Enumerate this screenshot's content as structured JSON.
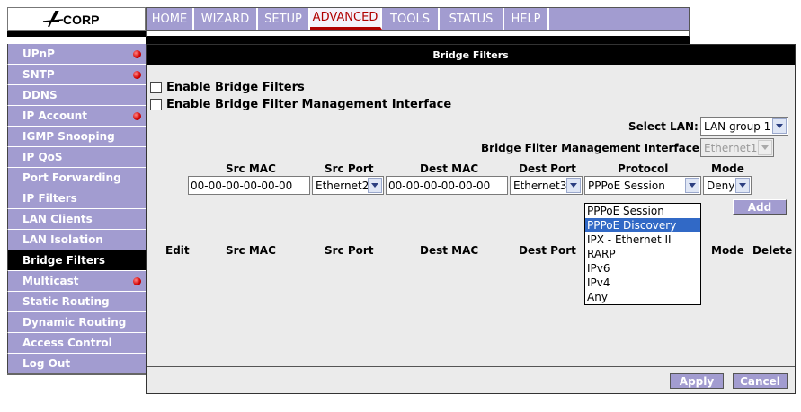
{
  "brand": "ACORP",
  "topnav": {
    "tabs": [
      {
        "label": "HOME",
        "active": false
      },
      {
        "label": "WIZARD",
        "active": false
      },
      {
        "label": "SETUP",
        "active": false
      },
      {
        "label": "ADVANCED",
        "active": true
      },
      {
        "label": "TOOLS",
        "active": false
      },
      {
        "label": "STATUS",
        "active": false
      },
      {
        "label": "HELP",
        "active": false
      }
    ]
  },
  "sidebar": {
    "items": [
      {
        "label": "UPnP",
        "dot": true
      },
      {
        "label": "SNTP",
        "dot": true
      },
      {
        "label": "DDNS",
        "dot": false
      },
      {
        "label": "IP Account",
        "dot": true
      },
      {
        "label": "IGMP Snooping",
        "dot": false
      },
      {
        "label": "IP QoS",
        "dot": false
      },
      {
        "label": "Port Forwarding",
        "dot": false
      },
      {
        "label": "IP Filters",
        "dot": false
      },
      {
        "label": "LAN Clients",
        "dot": false
      },
      {
        "label": "LAN Isolation",
        "dot": false
      },
      {
        "label": "Bridge Filters",
        "dot": false,
        "active": true
      },
      {
        "label": "Multicast",
        "dot": true
      },
      {
        "label": "Static Routing",
        "dot": false
      },
      {
        "label": "Dynamic Routing",
        "dot": false
      },
      {
        "label": "Access Control",
        "dot": false
      },
      {
        "label": "Log Out",
        "dot": false
      }
    ]
  },
  "main": {
    "title": "Bridge Filters",
    "enable_bridge_filters": "Enable Bridge Filters",
    "enable_mgmt_interface": "Enable Bridge Filter Management Interface",
    "select_lan_label": "Select LAN:",
    "select_lan_value": "LAN group 1",
    "mgmt_interface_label": "Bridge Filter Management Interface:",
    "mgmt_interface_value": "Ethernet1",
    "form_headers": {
      "src_mac": "Src MAC",
      "src_port": "Src Port",
      "dest_mac": "Dest MAC",
      "dest_port": "Dest Port",
      "protocol": "Protocol",
      "mode": "Mode"
    },
    "form_values": {
      "src_mac": "00-00-00-00-00-00",
      "src_port": "Ethernet2",
      "dest_mac": "00-00-00-00-00-00",
      "dest_port": "Ethernet3",
      "protocol": "PPPoE Session",
      "mode": "Deny"
    },
    "protocol_options": [
      "PPPoE Session",
      "PPPoE Discovery",
      "IPX - Ethernet II",
      "RARP",
      "IPv6",
      "IPv4",
      "Any"
    ],
    "protocol_highlighted": "PPPoE Discovery",
    "add_label": "Add",
    "table_headers": {
      "edit": "Edit",
      "src_mac": "Src MAC",
      "src_port": "Src Port",
      "dest_mac": "Dest MAC",
      "dest_port": "Dest Port",
      "mode": "Mode",
      "delete": "Delete"
    },
    "apply_label": "Apply",
    "cancel_label": "Cancel"
  },
  "colors": {
    "nav_bg": "#a29cd0",
    "active_tab_text": "#b00000",
    "panel_bg": "#ebebeb",
    "highlight": "#3169c6",
    "status_dot": "#d00000"
  }
}
